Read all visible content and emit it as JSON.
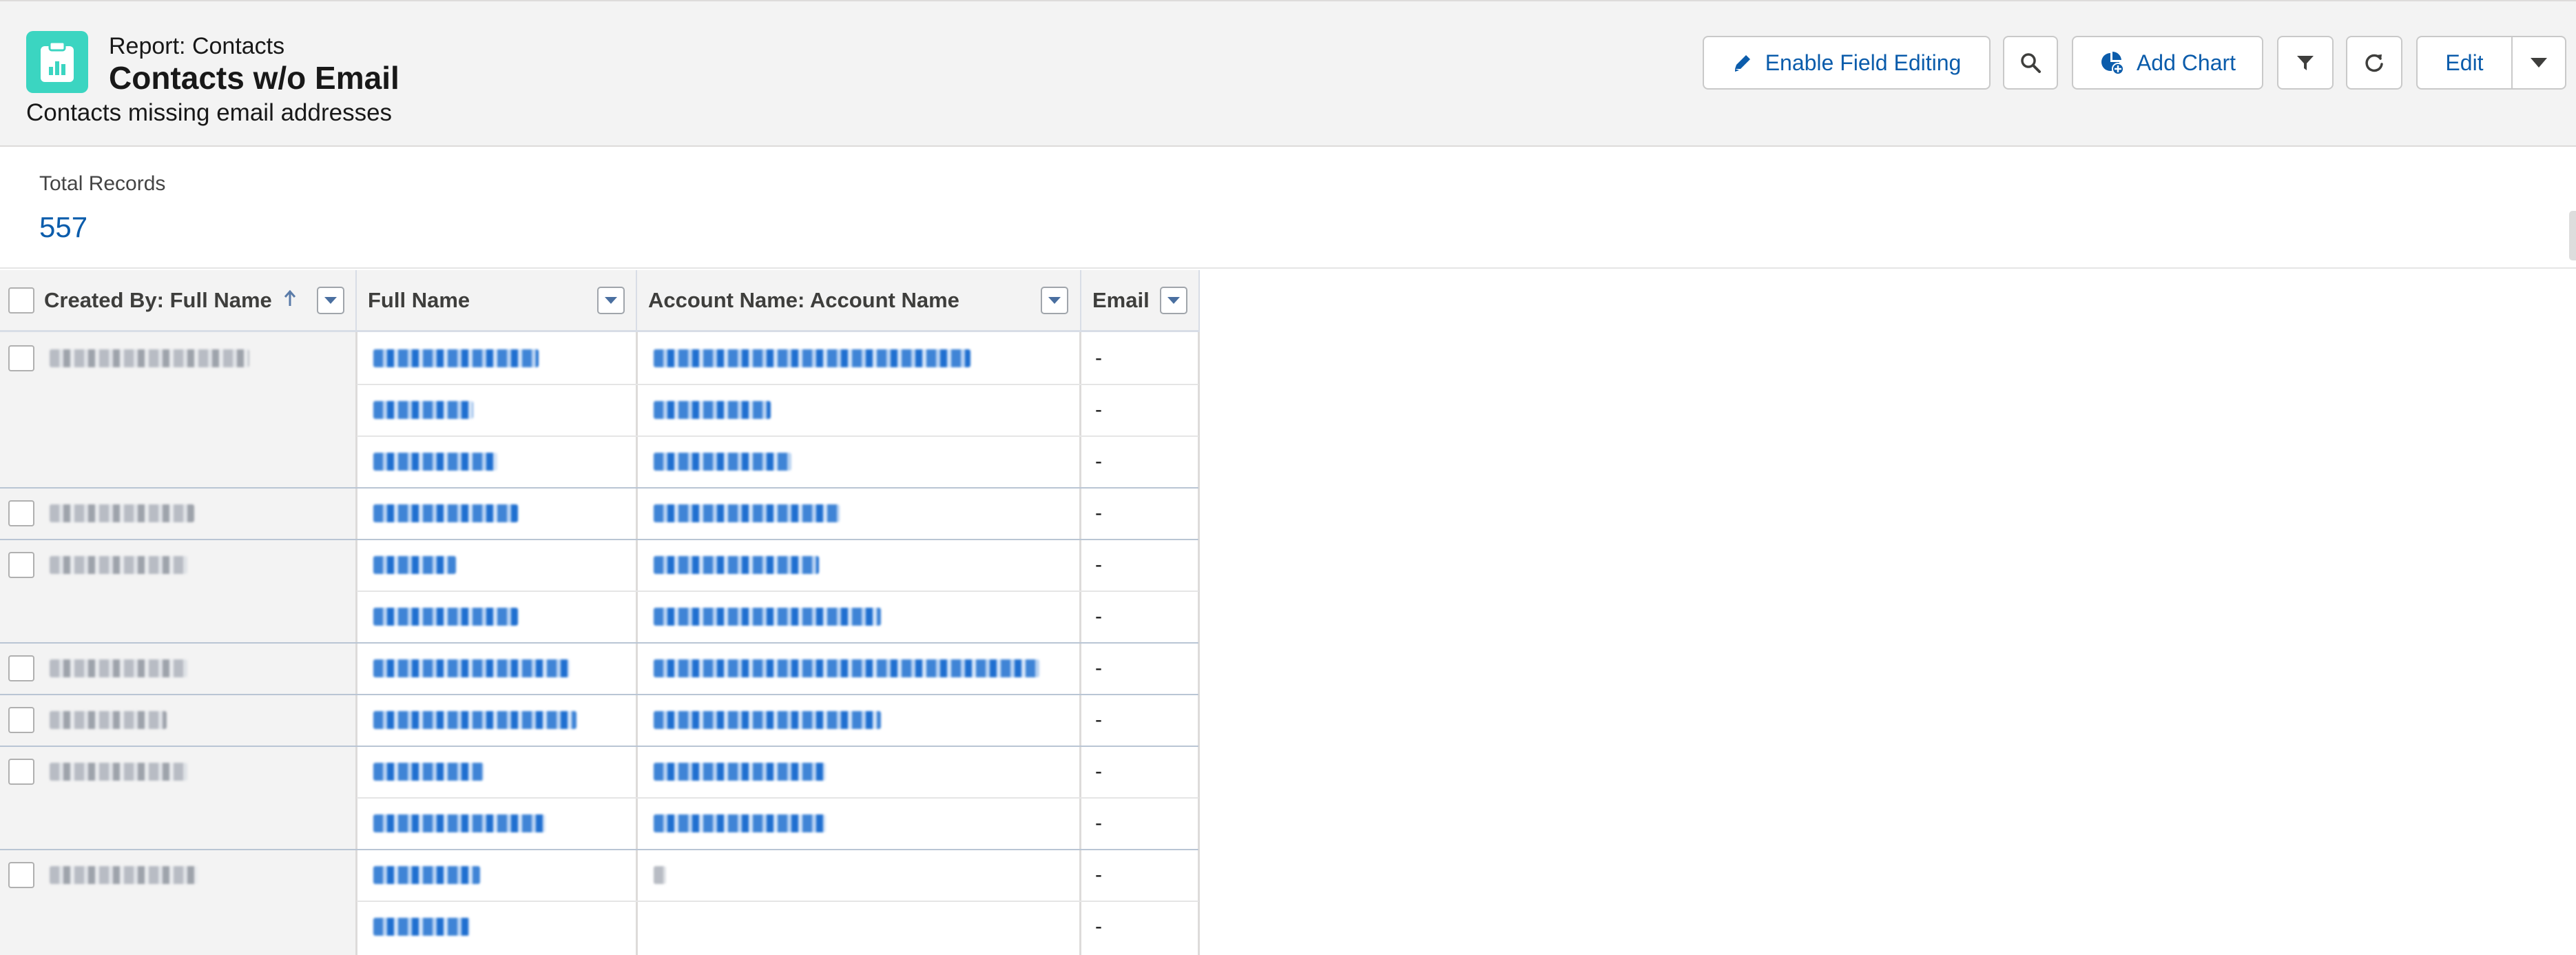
{
  "header": {
    "object_label": "Report: Contacts",
    "title": "Contacts w/o Email",
    "description": "Contacts missing email addresses",
    "icon": "report-clipboard-icon"
  },
  "toolbar": {
    "enable_field_editing": "Enable Field Editing",
    "search_icon": "search-icon",
    "add_chart": "Add Chart",
    "filter_icon": "filter-icon",
    "refresh_icon": "refresh-icon",
    "edit": "Edit",
    "more_icon": "chevron-down-icon"
  },
  "summary": {
    "label": "Total Records",
    "value": "557"
  },
  "table": {
    "columns": [
      {
        "label": "Created By: Full Name",
        "sorted": "ascending"
      },
      {
        "label": "Full Name"
      },
      {
        "label": "Account Name: Account Name"
      },
      {
        "label": "Email"
      }
    ],
    "rows": [
      {
        "email": "-"
      },
      {
        "email": "-"
      },
      {
        "email": "-"
      },
      {
        "email": "-"
      },
      {
        "email": "-"
      },
      {
        "email": "-"
      },
      {
        "email": "-"
      },
      {
        "email": "-"
      },
      {
        "email": "-"
      },
      {
        "email": "-"
      },
      {
        "email": "-"
      },
      {
        "email": "-"
      }
    ]
  },
  "colors": {
    "accent": "#0b5cab",
    "app_icon": "#3bd5c1",
    "header_bg": "#f3f3f3"
  }
}
